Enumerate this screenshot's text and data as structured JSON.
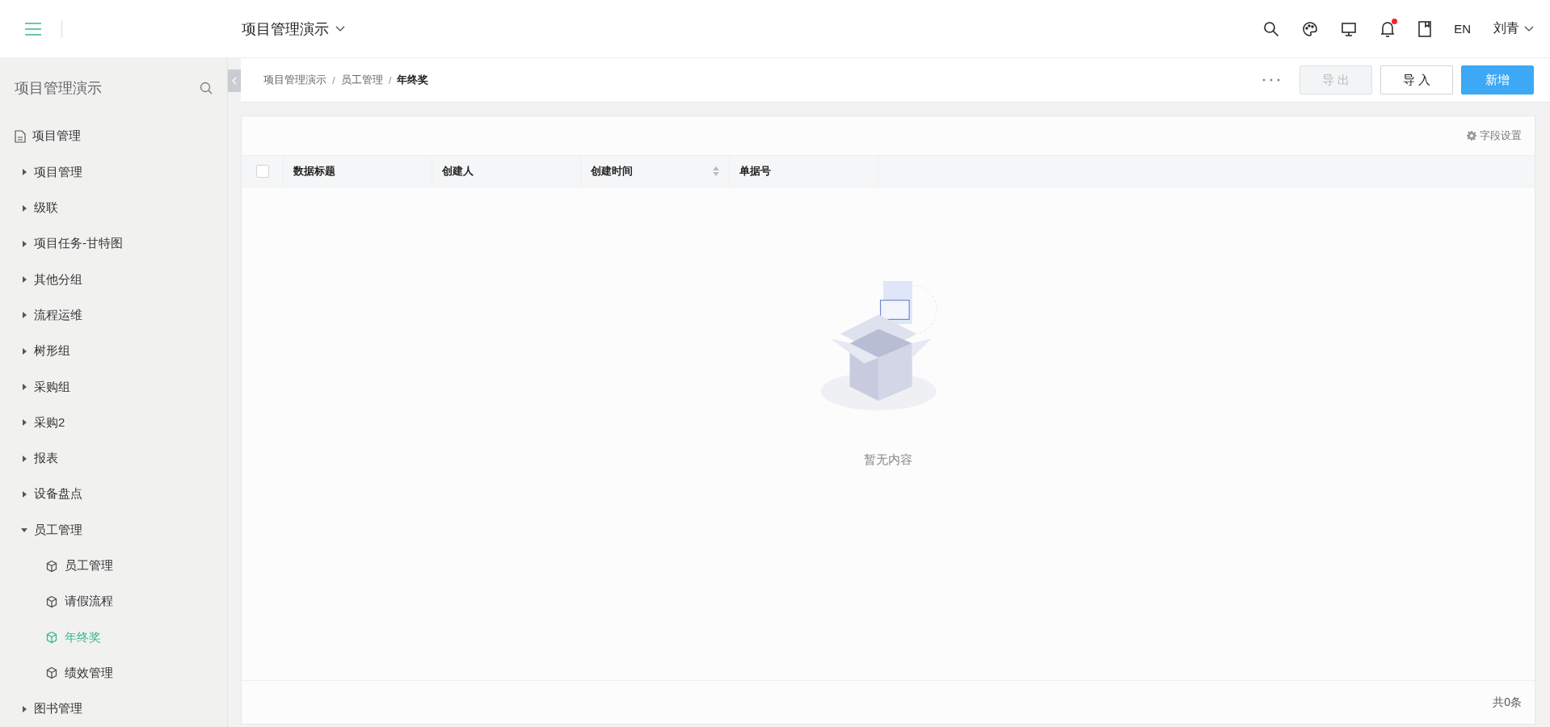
{
  "header": {
    "app_title": "项目管理演示",
    "language": "EN",
    "user": "刘青",
    "notifications": {
      "unread": true
    }
  },
  "sidebar": {
    "title": "项目管理演示",
    "items": [
      {
        "label": "项目管理",
        "kind": "document",
        "selected": false
      },
      {
        "label": "项目管理",
        "kind": "group",
        "expanded": false,
        "selected": false
      },
      {
        "label": "级联",
        "kind": "group",
        "expanded": false,
        "selected": false
      },
      {
        "label": "项目任务-甘特图",
        "kind": "group",
        "expanded": false,
        "selected": false
      },
      {
        "label": "其他分组",
        "kind": "group",
        "expanded": false,
        "selected": false
      },
      {
        "label": "流程运维",
        "kind": "group",
        "expanded": false,
        "selected": false
      },
      {
        "label": "树形组",
        "kind": "group",
        "expanded": false,
        "selected": false
      },
      {
        "label": "采购组",
        "kind": "group",
        "expanded": false,
        "selected": false
      },
      {
        "label": "采购2",
        "kind": "group",
        "expanded": false,
        "selected": false
      },
      {
        "label": "报表",
        "kind": "group",
        "expanded": false,
        "selected": false
      },
      {
        "label": "设备盘点",
        "kind": "group",
        "expanded": false,
        "selected": false
      },
      {
        "label": "员工管理",
        "kind": "group",
        "expanded": true,
        "selected": false,
        "children": [
          {
            "label": "员工管理",
            "kind": "form",
            "selected": false
          },
          {
            "label": "请假流程",
            "kind": "form",
            "selected": false
          },
          {
            "label": "年终奖",
            "kind": "form",
            "selected": true
          },
          {
            "label": "绩效管理",
            "kind": "form",
            "selected": false
          }
        ]
      },
      {
        "label": "图书管理",
        "kind": "group",
        "expanded": false,
        "selected": false
      }
    ]
  },
  "breadcrumb": {
    "separator": "/",
    "items": [
      "项目管理演示",
      "员工管理",
      "年终奖"
    ]
  },
  "toolbar": {
    "buttons": [
      {
        "label": "导 出",
        "kind": "default",
        "disabled": true
      },
      {
        "label": "导 入",
        "kind": "default",
        "disabled": false
      },
      {
        "label": "新增",
        "kind": "primary",
        "disabled": false
      }
    ]
  },
  "table": {
    "settings_label": "字段设置",
    "select_all": {
      "checked": false
    },
    "columns": [
      {
        "label": "数据标题",
        "sortable": false
      },
      {
        "label": "创建人",
        "sortable": false
      },
      {
        "label": "创建时间",
        "sortable": true
      },
      {
        "label": "单据号",
        "sortable": false
      }
    ],
    "empty_text": "暂无内容",
    "total": "共0条"
  }
}
